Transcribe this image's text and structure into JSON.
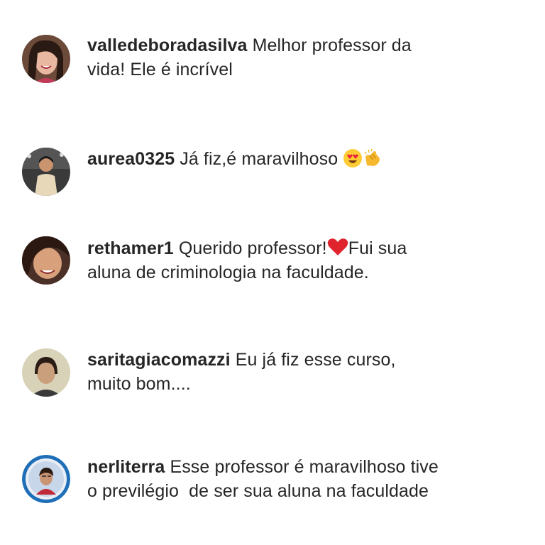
{
  "comments": [
    {
      "username": "valledeboradasilva",
      "parts": [
        "Melhor professor da",
        "vida! Ele é incrível"
      ]
    },
    {
      "username": "aurea0325",
      "text": "Já fiz,é maravilhoso",
      "emojis": [
        "heart-eyes-emoji",
        "clapping-hands-emoji"
      ]
    },
    {
      "username": "rethamer1",
      "text_before": "Querido professor!",
      "emoji": "red-heart-emoji",
      "text_after": "Fui sua",
      "line2": "aluna de criminologia na faculdade."
    },
    {
      "username": "saritagiacomazzi",
      "line1": "Eu já fiz esse curso,",
      "line2": "muito bom...."
    },
    {
      "username": "nerliterra",
      "line1": "Esse professor é maravilhoso tive",
      "line2": "o previlégio  de ser sua aluna na faculdade"
    }
  ],
  "colors": {
    "text": "#262626",
    "background": "#ffffff"
  }
}
